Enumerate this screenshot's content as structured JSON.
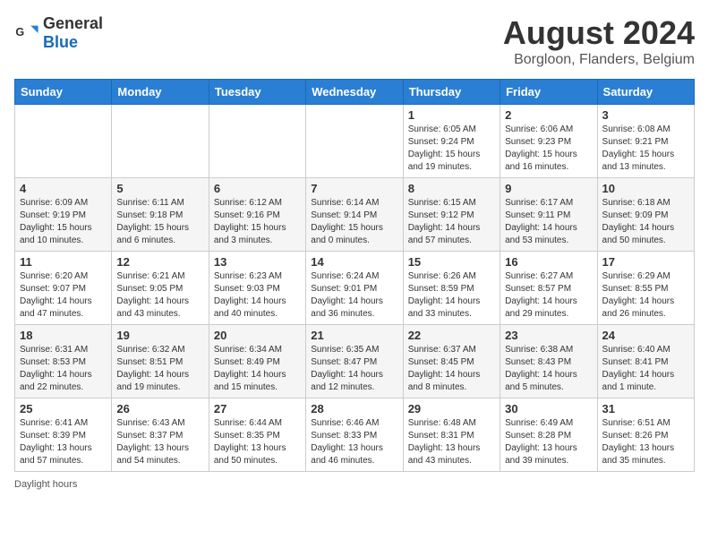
{
  "header": {
    "logo_general": "General",
    "logo_blue": "Blue",
    "month_year": "August 2024",
    "location": "Borgloon, Flanders, Belgium"
  },
  "days_of_week": [
    "Sunday",
    "Monday",
    "Tuesday",
    "Wednesday",
    "Thursday",
    "Friday",
    "Saturday"
  ],
  "weeks": [
    [
      {
        "day": "",
        "info": ""
      },
      {
        "day": "",
        "info": ""
      },
      {
        "day": "",
        "info": ""
      },
      {
        "day": "",
        "info": ""
      },
      {
        "day": "1",
        "info": "Sunrise: 6:05 AM\nSunset: 9:24 PM\nDaylight: 15 hours\nand 19 minutes."
      },
      {
        "day": "2",
        "info": "Sunrise: 6:06 AM\nSunset: 9:23 PM\nDaylight: 15 hours\nand 16 minutes."
      },
      {
        "day": "3",
        "info": "Sunrise: 6:08 AM\nSunset: 9:21 PM\nDaylight: 15 hours\nand 13 minutes."
      }
    ],
    [
      {
        "day": "4",
        "info": "Sunrise: 6:09 AM\nSunset: 9:19 PM\nDaylight: 15 hours\nand 10 minutes."
      },
      {
        "day": "5",
        "info": "Sunrise: 6:11 AM\nSunset: 9:18 PM\nDaylight: 15 hours\nand 6 minutes."
      },
      {
        "day": "6",
        "info": "Sunrise: 6:12 AM\nSunset: 9:16 PM\nDaylight: 15 hours\nand 3 minutes."
      },
      {
        "day": "7",
        "info": "Sunrise: 6:14 AM\nSunset: 9:14 PM\nDaylight: 15 hours\nand 0 minutes."
      },
      {
        "day": "8",
        "info": "Sunrise: 6:15 AM\nSunset: 9:12 PM\nDaylight: 14 hours\nand 57 minutes."
      },
      {
        "day": "9",
        "info": "Sunrise: 6:17 AM\nSunset: 9:11 PM\nDaylight: 14 hours\nand 53 minutes."
      },
      {
        "day": "10",
        "info": "Sunrise: 6:18 AM\nSunset: 9:09 PM\nDaylight: 14 hours\nand 50 minutes."
      }
    ],
    [
      {
        "day": "11",
        "info": "Sunrise: 6:20 AM\nSunset: 9:07 PM\nDaylight: 14 hours\nand 47 minutes."
      },
      {
        "day": "12",
        "info": "Sunrise: 6:21 AM\nSunset: 9:05 PM\nDaylight: 14 hours\nand 43 minutes."
      },
      {
        "day": "13",
        "info": "Sunrise: 6:23 AM\nSunset: 9:03 PM\nDaylight: 14 hours\nand 40 minutes."
      },
      {
        "day": "14",
        "info": "Sunrise: 6:24 AM\nSunset: 9:01 PM\nDaylight: 14 hours\nand 36 minutes."
      },
      {
        "day": "15",
        "info": "Sunrise: 6:26 AM\nSunset: 8:59 PM\nDaylight: 14 hours\nand 33 minutes."
      },
      {
        "day": "16",
        "info": "Sunrise: 6:27 AM\nSunset: 8:57 PM\nDaylight: 14 hours\nand 29 minutes."
      },
      {
        "day": "17",
        "info": "Sunrise: 6:29 AM\nSunset: 8:55 PM\nDaylight: 14 hours\nand 26 minutes."
      }
    ],
    [
      {
        "day": "18",
        "info": "Sunrise: 6:31 AM\nSunset: 8:53 PM\nDaylight: 14 hours\nand 22 minutes."
      },
      {
        "day": "19",
        "info": "Sunrise: 6:32 AM\nSunset: 8:51 PM\nDaylight: 14 hours\nand 19 minutes."
      },
      {
        "day": "20",
        "info": "Sunrise: 6:34 AM\nSunset: 8:49 PM\nDaylight: 14 hours\nand 15 minutes."
      },
      {
        "day": "21",
        "info": "Sunrise: 6:35 AM\nSunset: 8:47 PM\nDaylight: 14 hours\nand 12 minutes."
      },
      {
        "day": "22",
        "info": "Sunrise: 6:37 AM\nSunset: 8:45 PM\nDaylight: 14 hours\nand 8 minutes."
      },
      {
        "day": "23",
        "info": "Sunrise: 6:38 AM\nSunset: 8:43 PM\nDaylight: 14 hours\nand 5 minutes."
      },
      {
        "day": "24",
        "info": "Sunrise: 6:40 AM\nSunset: 8:41 PM\nDaylight: 14 hours\nand 1 minute."
      }
    ],
    [
      {
        "day": "25",
        "info": "Sunrise: 6:41 AM\nSunset: 8:39 PM\nDaylight: 13 hours\nand 57 minutes."
      },
      {
        "day": "26",
        "info": "Sunrise: 6:43 AM\nSunset: 8:37 PM\nDaylight: 13 hours\nand 54 minutes."
      },
      {
        "day": "27",
        "info": "Sunrise: 6:44 AM\nSunset: 8:35 PM\nDaylight: 13 hours\nand 50 minutes."
      },
      {
        "day": "28",
        "info": "Sunrise: 6:46 AM\nSunset: 8:33 PM\nDaylight: 13 hours\nand 46 minutes."
      },
      {
        "day": "29",
        "info": "Sunrise: 6:48 AM\nSunset: 8:31 PM\nDaylight: 13 hours\nand 43 minutes."
      },
      {
        "day": "30",
        "info": "Sunrise: 6:49 AM\nSunset: 8:28 PM\nDaylight: 13 hours\nand 39 minutes."
      },
      {
        "day": "31",
        "info": "Sunrise: 6:51 AM\nSunset: 8:26 PM\nDaylight: 13 hours\nand 35 minutes."
      }
    ]
  ],
  "footer": {
    "label": "Daylight hours"
  }
}
